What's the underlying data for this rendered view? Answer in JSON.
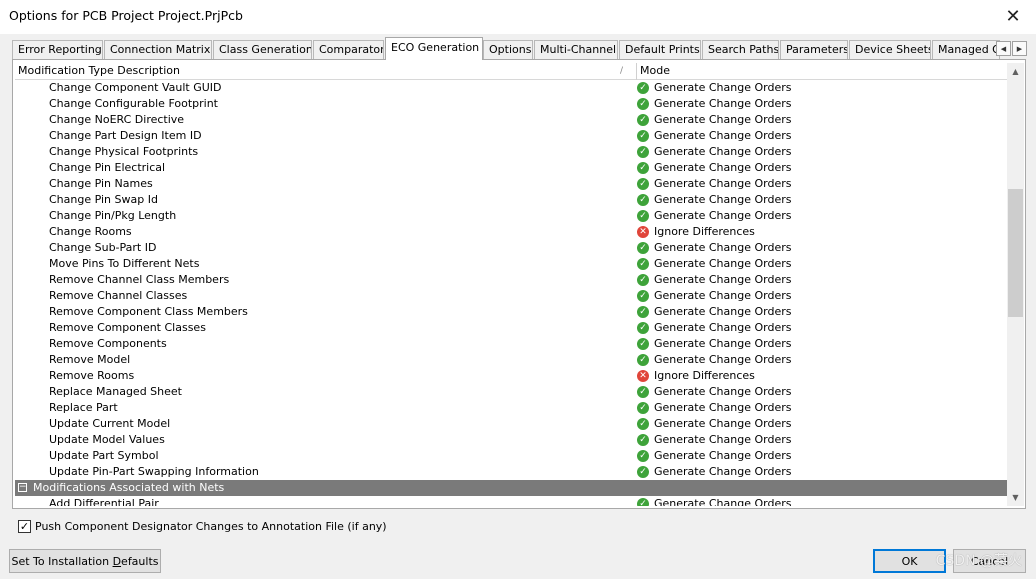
{
  "window": {
    "title": "Options for PCB Project Project.PrjPcb",
    "close_icon": "close-icon"
  },
  "tabs": [
    {
      "label": "Error Reporting"
    },
    {
      "label": "Connection Matrix"
    },
    {
      "label": "Class Generation"
    },
    {
      "label": "Comparator"
    },
    {
      "label": "ECO Generation",
      "active": true
    },
    {
      "label": "Options"
    },
    {
      "label": "Multi-Channel"
    },
    {
      "label": "Default Prints"
    },
    {
      "label": "Search Paths"
    },
    {
      "label": "Parameters"
    },
    {
      "label": "Device Sheets"
    },
    {
      "label": "Managed O"
    }
  ],
  "tab_scroll": {
    "left": "◀",
    "right": "▶"
  },
  "grid": {
    "col1_header": "Modification Type Description",
    "col2_header": "Mode",
    "sort_mark": "/",
    "rows": [
      {
        "desc": "Change Component Vault GUID",
        "mode": "Generate Change Orders",
        "status": "ok"
      },
      {
        "desc": "Change Configurable Footprint",
        "mode": "Generate Change Orders",
        "status": "ok"
      },
      {
        "desc": "Change NoERC Directive",
        "mode": "Generate Change Orders",
        "status": "ok"
      },
      {
        "desc": "Change Part Design Item ID",
        "mode": "Generate Change Orders",
        "status": "ok"
      },
      {
        "desc": "Change Physical Footprints",
        "mode": "Generate Change Orders",
        "status": "ok"
      },
      {
        "desc": "Change Pin Electrical",
        "mode": "Generate Change Orders",
        "status": "ok"
      },
      {
        "desc": "Change Pin Names",
        "mode": "Generate Change Orders",
        "status": "ok"
      },
      {
        "desc": "Change Pin Swap Id",
        "mode": "Generate Change Orders",
        "status": "ok"
      },
      {
        "desc": "Change Pin/Pkg Length",
        "mode": "Generate Change Orders",
        "status": "ok"
      },
      {
        "desc": "Change Rooms",
        "mode": "Ignore Differences",
        "status": "no"
      },
      {
        "desc": "Change Sub-Part ID",
        "mode": "Generate Change Orders",
        "status": "ok"
      },
      {
        "desc": "Move Pins To Different Nets",
        "mode": "Generate Change Orders",
        "status": "ok"
      },
      {
        "desc": "Remove Channel Class Members",
        "mode": "Generate Change Orders",
        "status": "ok"
      },
      {
        "desc": "Remove Channel Classes",
        "mode": "Generate Change Orders",
        "status": "ok"
      },
      {
        "desc": "Remove Component Class Members",
        "mode": "Generate Change Orders",
        "status": "ok"
      },
      {
        "desc": "Remove Component Classes",
        "mode": "Generate Change Orders",
        "status": "ok"
      },
      {
        "desc": "Remove Components",
        "mode": "Generate Change Orders",
        "status": "ok"
      },
      {
        "desc": "Remove Model",
        "mode": "Generate Change Orders",
        "status": "ok"
      },
      {
        "desc": "Remove Rooms",
        "mode": "Ignore Differences",
        "status": "no"
      },
      {
        "desc": "Replace Managed Sheet",
        "mode": "Generate Change Orders",
        "status": "ok"
      },
      {
        "desc": "Replace Part",
        "mode": "Generate Change Orders",
        "status": "ok"
      },
      {
        "desc": "Update Current Model",
        "mode": "Generate Change Orders",
        "status": "ok"
      },
      {
        "desc": "Update Model Values",
        "mode": "Generate Change Orders",
        "status": "ok"
      },
      {
        "desc": "Update Part Symbol",
        "mode": "Generate Change Orders",
        "status": "ok"
      },
      {
        "desc": "Update Pin-Part Swapping Information",
        "mode": "Generate Change Orders",
        "status": "ok"
      },
      {
        "group": "Modifications Associated with Nets",
        "collapse_glyph": "−"
      },
      {
        "desc": "Add Differential Pair",
        "mode": "Generate Change Orders",
        "status": "ok"
      }
    ]
  },
  "scrollbar": {
    "up": "▲",
    "down": "▼"
  },
  "checkbox": {
    "label": "Push Component Designator Changes to Annotation File (if any)",
    "checked": true,
    "mark": "✓"
  },
  "buttons": {
    "defaults_pre": "Set To Installation ",
    "defaults_u": "D",
    "defaults_post": "efaults",
    "ok": "OK",
    "cancel": "Cancel"
  },
  "watermark": "CSDN @菜火"
}
